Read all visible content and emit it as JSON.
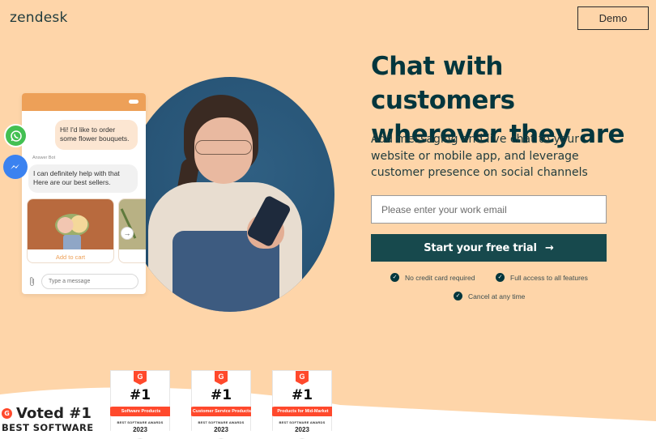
{
  "header": {
    "logo": "zendesk",
    "demo_label": "Demo"
  },
  "hero": {
    "headline": "Chat with customers wherever they are",
    "subhead": "Add messaging and live chat to your website or mobile app, and leverage customer presence on social channels",
    "email_placeholder": "Please enter your work email",
    "email_value": "",
    "cta_label": "Start your free trial",
    "cta_arrow": "→",
    "perks": [
      "No credit card required",
      "Full access to all features",
      "Cancel at any time"
    ]
  },
  "chat_widget": {
    "user_message": "Hi! I'd like to order some flower bouquets.",
    "bot_name": "Answer Bot",
    "bot_message": "I can definitely help with that Here are our best sellers.",
    "product_cta": "Add to cart",
    "input_placeholder": "Type a message",
    "channels": [
      "whatsapp-icon",
      "messenger-icon"
    ]
  },
  "awards": {
    "voted_label": "Voted #1",
    "best_label": "BEST SOFTWARE",
    "badges": [
      {
        "rank": "#1",
        "category": "Software Products",
        "award": "BEST SOFTWARE AWARDS",
        "year": "2023"
      },
      {
        "rank": "#1",
        "category": "Customer Service Products",
        "award": "BEST SOFTWARE AWARDS",
        "year": "2023"
      },
      {
        "rank": "#1",
        "category": "Products for Mid-Market",
        "award": "BEST SOFTWARE AWARDS",
        "year": "2023"
      }
    ]
  },
  "colors": {
    "background": "#FED5A9",
    "primary": "#03363D",
    "cta": "#17494D",
    "chat_accent": "#EDA058",
    "g2_red": "#FF492C"
  }
}
